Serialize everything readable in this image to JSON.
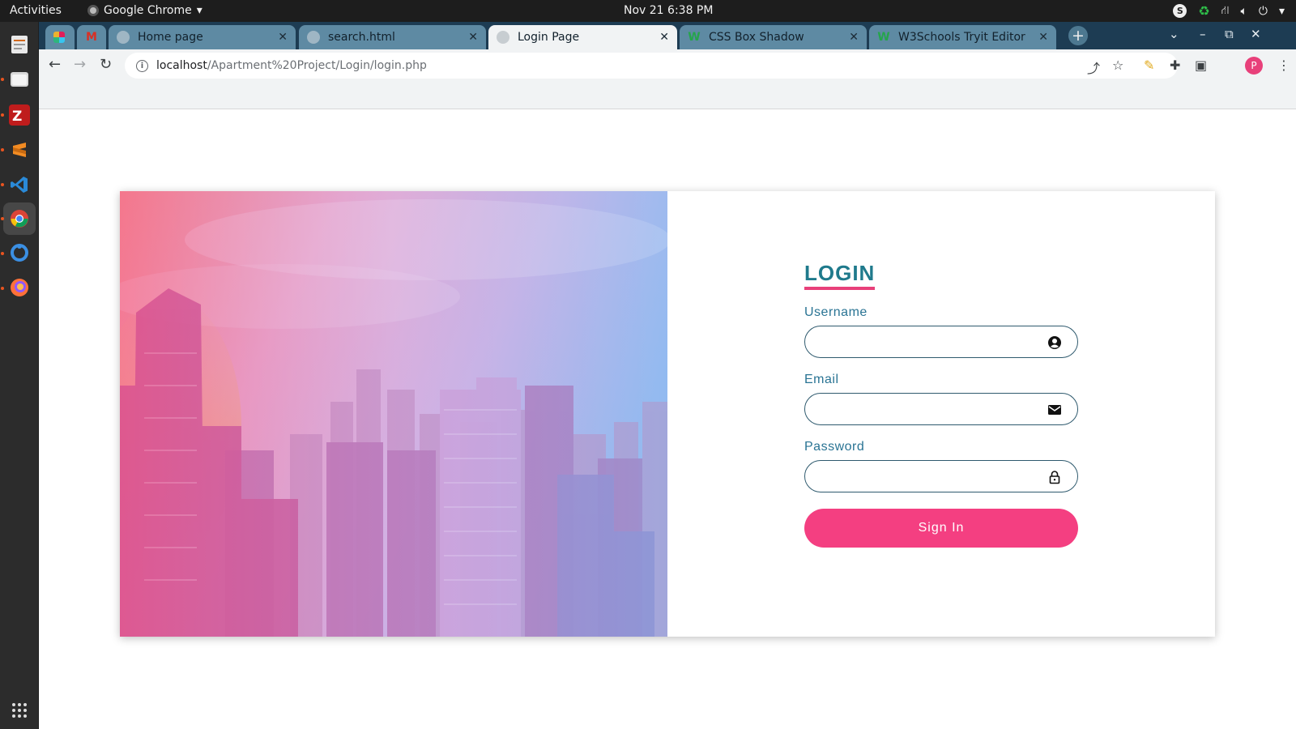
{
  "system_bar": {
    "activities": "Activities",
    "app_name": "Google Chrome",
    "clock": "Nov 21  6:38 PM"
  },
  "browser": {
    "tabs": [
      {
        "label": "",
        "favicon": "slack-icon"
      },
      {
        "label": "",
        "favicon": "gmail-icon"
      },
      {
        "label": "Home page",
        "favicon": "globe-icon"
      },
      {
        "label": "search.html",
        "favicon": "globe-icon"
      },
      {
        "label": "Login Page",
        "favicon": "globe-icon",
        "active": true
      },
      {
        "label": "CSS Box Shadow",
        "favicon": "w3schools-icon"
      },
      {
        "label": "W3Schools Tryit Editor",
        "favicon": "w3schools-icon"
      }
    ],
    "url_host": "localhost",
    "url_path": "/Apartment%20Project/Login/login.php",
    "profile_initial": "P"
  },
  "login": {
    "title": "LOGIN",
    "username_label": "Username",
    "email_label": "Email",
    "password_label": "Password",
    "username_value": "",
    "email_value": "",
    "password_value": "",
    "submit_label": "Sign In",
    "colors": {
      "accent": "#1f7a8c",
      "brand_pink": "#f43f81",
      "label": "#2a7494"
    }
  }
}
